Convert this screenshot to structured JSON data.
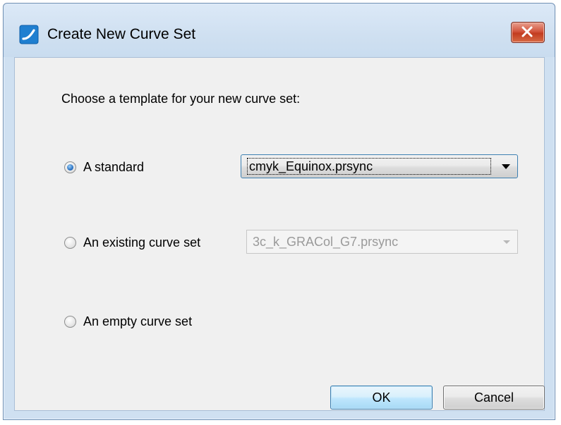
{
  "dialog": {
    "title": "Create New Curve Set",
    "prompt": "Choose a template for your new curve set:"
  },
  "options": [
    {
      "label": "A standard",
      "selected": true,
      "combo_value": "cmyk_Equinox.prsync",
      "combo_enabled": true
    },
    {
      "label": "An existing curve set",
      "selected": false,
      "combo_value": "3c_k_GRACol_G7.prsync",
      "combo_enabled": false
    },
    {
      "label": "An empty curve set",
      "selected": false
    }
  ],
  "buttons": {
    "ok_label": "OK",
    "cancel_label": "Cancel"
  },
  "icons": {
    "app": "curve-app-icon",
    "close": "close-icon",
    "dropdown": "chevron-down-icon"
  },
  "colors": {
    "titlebar": "#cfe0f1",
    "client_bg": "#f0f0f0",
    "close_button": "#c23c20",
    "radio_selected": "#2b73c4",
    "default_button_border": "#3c7fb1"
  }
}
